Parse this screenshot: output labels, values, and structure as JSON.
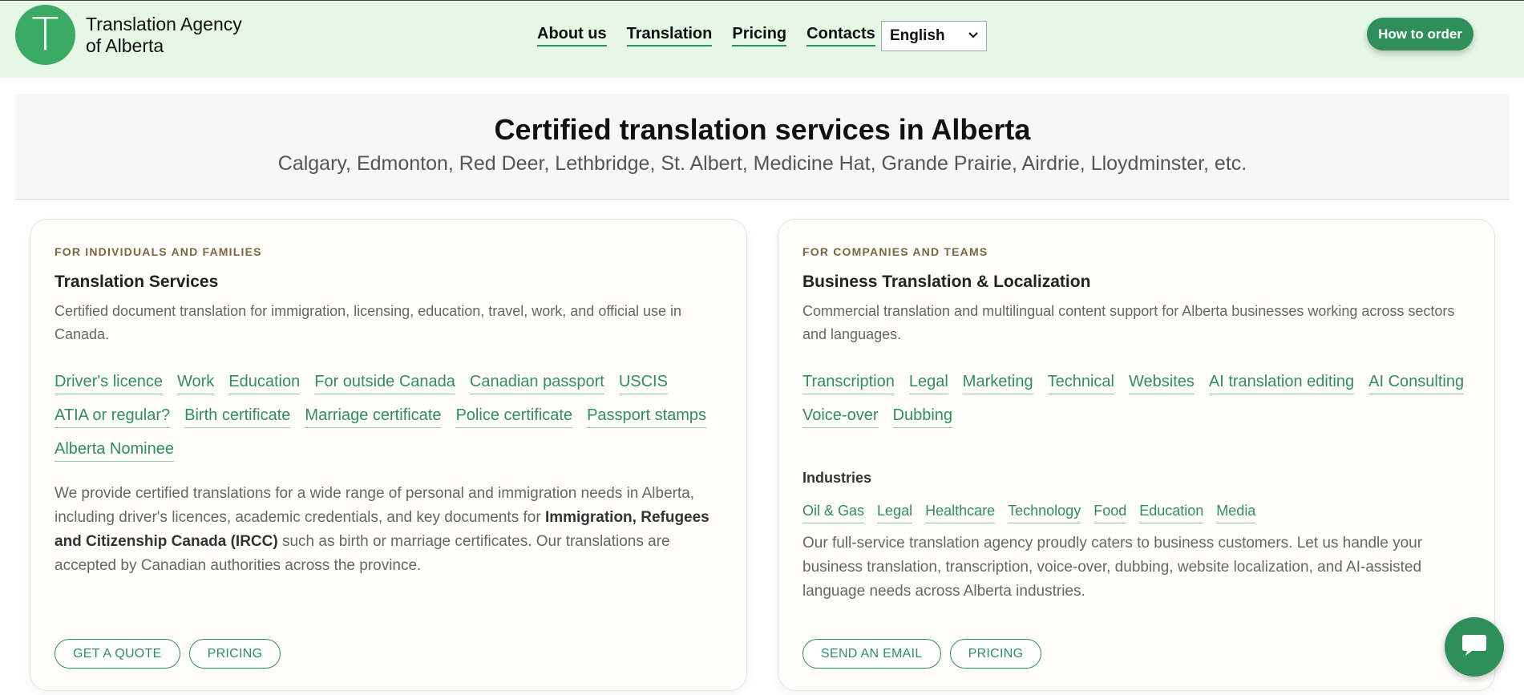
{
  "header": {
    "logo_letter": "T",
    "logo_line1": "Translation Agency",
    "logo_line2": "of Alberta",
    "nav": [
      "About us",
      "Translation",
      "Pricing",
      "Contacts"
    ],
    "language": "English",
    "cta": "How to order",
    "background": "#e6f7e6",
    "accent": "#2f8f5b"
  },
  "hero": {
    "title": "Certified translation services in Alberta",
    "cities": "Calgary, Edmonton, Red Deer, Lethbridge, St. Albert, Medicine Hat, Grande Prairie, Airdrie, Lloydminster, etc."
  },
  "individuals": {
    "eyebrow": "FOR INDIVIDUALS AND FAMILIES",
    "title": "Translation Services",
    "desc": "Certified document translation for immigration, licensing, education, travel, work, and official use in Canada.",
    "links": [
      "Driver's licence",
      "Work",
      "Education",
      "For outside Canada",
      "Canadian passport",
      "USCIS",
      "ATIA or regular?",
      "Birth certificate",
      "Marriage certificate",
      "Police certificate",
      "Passport stamps",
      "Alberta Nominee"
    ],
    "body_part1": "We provide certified translations for a wide range of personal and immigration needs in Alberta, including driver's licences, academic credentials, and key documents for ",
    "body_bold": "Immigration, Refugees and Citizenship Canada (IRCC)",
    "body_part2": " such as birth or marriage certificates. Our translations are accepted by Canadian authorities across the province.",
    "btn_quote": "GET A QUOTE",
    "btn_pricing": "PRICING"
  },
  "companies": {
    "eyebrow": "FOR COMPANIES AND TEAMS",
    "title": "Business Translation & Localization",
    "desc": "Commercial translation and multilingual content support for Alberta businesses working across sectors and languages.",
    "links": [
      "Transcription",
      "Legal",
      "Marketing",
      "Technical",
      "Websites",
      "AI translation editing",
      "AI Consulting",
      "Voice-over",
      "Dubbing"
    ],
    "industries_title": "Industries",
    "industries": [
      "Oil & Gas",
      "Legal",
      "Healthcare",
      "Technology",
      "Food",
      "Education",
      "Media"
    ],
    "body": "Our full-service translation agency proudly caters to business customers. Let us handle your business translation, transcription, voice-over, dubbing, website localization, and AI-assisted language needs across Alberta industries.",
    "btn_email": "SEND AN EMAIL",
    "btn_pricing": "PRICING"
  },
  "chat": {
    "icon": "chat-bubble-icon"
  }
}
